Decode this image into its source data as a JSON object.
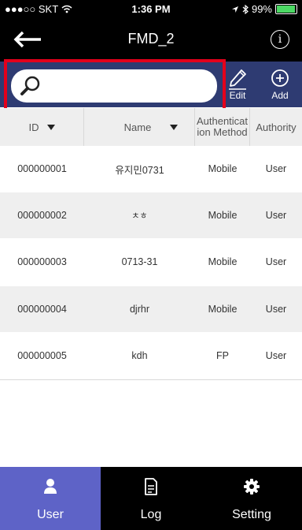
{
  "status": {
    "carrier": "●●●○○ SKT",
    "time": "1:36 PM",
    "battery": "99%",
    "battery_level": 0.99
  },
  "nav": {
    "title": "FMD_2",
    "info_label": "i"
  },
  "toolbar": {
    "search_placeholder": "",
    "edit_label": "Edit",
    "add_label": "Add"
  },
  "table": {
    "headers": [
      "ID",
      "Name",
      "Authenticat ion Method",
      "Authority"
    ],
    "rows": [
      [
        "000000001",
        "유지민0731",
        "Mobile",
        "User"
      ],
      [
        "000000002",
        "ㅊㅎ",
        "Mobile",
        "User"
      ],
      [
        "000000003",
        "0713-31",
        "Mobile",
        "User"
      ],
      [
        "000000004",
        "djrhr",
        "Mobile",
        "User"
      ],
      [
        "000000005",
        "kdh",
        "FP",
        "User"
      ]
    ]
  },
  "tabs": [
    {
      "label": "User",
      "icon": "user-icon"
    },
    {
      "label": "Log",
      "icon": "document-icon"
    },
    {
      "label": "Setting",
      "icon": "gear-icon"
    }
  ],
  "colors": {
    "toolbar": "#2e3b72",
    "active_tab": "#5e63c7",
    "highlight": "#e3001b"
  }
}
